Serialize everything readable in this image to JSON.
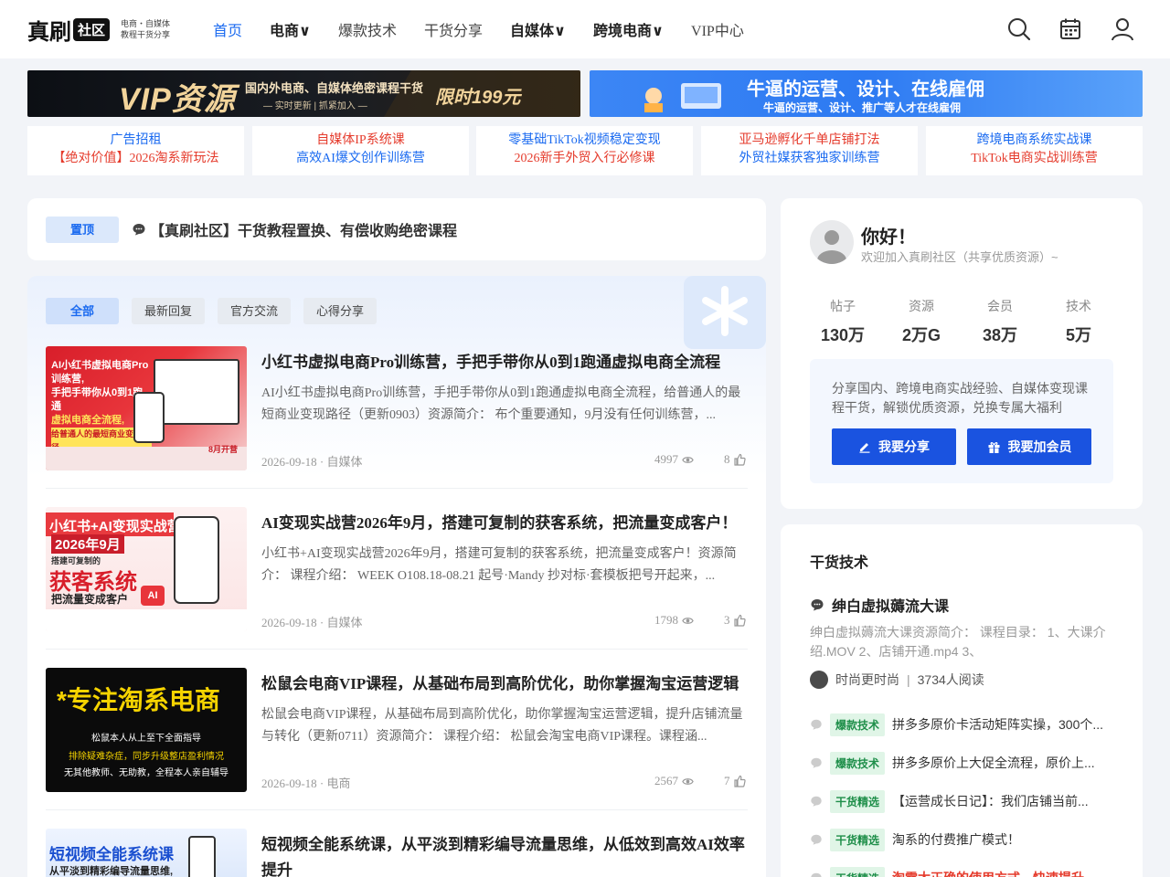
{
  "header": {
    "logo_main": "真刷",
    "logo_badge": "社区",
    "logo_sub_1": "电商・自媒体",
    "logo_sub_2": "教程干货分享",
    "nav": [
      {
        "label": "首页"
      },
      {
        "label": "电商∨"
      },
      {
        "label": "爆款技术"
      },
      {
        "label": "干货分享"
      },
      {
        "label": "自媒体∨"
      },
      {
        "label": "跨境电商∨"
      },
      {
        "label": "VIP中心"
      }
    ]
  },
  "banners": {
    "vip": {
      "big": "VIP资源",
      "line1": "国内外电商、自媒体绝密课程干货",
      "line2": "— 实时更新 | 抓紧加入 —",
      "price": "限时199元"
    },
    "hire": {
      "big": "牛逼的运营、设计、在线雇佣",
      "small": "牛逼的运营、设计、推广等人才在线雇佣"
    }
  },
  "ads": [
    {
      "line1": "广告招租",
      "line2": "【绝对价值】2026淘系新玩法"
    },
    {
      "line1": "自媒体IP系统课",
      "line2": "高效AI爆文创作训练营"
    },
    {
      "line1": "零基础TikTok视频稳定变现",
      "line2": "2026新手外贸入行必修课"
    },
    {
      "line1": "亚马逊孵化千单店铺打法",
      "line2": "外贸社媒获客独家训练营"
    },
    {
      "line1": "跨境电商系统实战课",
      "line2": "TikTok电商实战训练营"
    }
  ],
  "pinned": {
    "badge": "置顶",
    "title": "【真刷社区】干货教程置换、有偿收购绝密课程"
  },
  "tabs": [
    {
      "label": "全部"
    },
    {
      "label": "最新回复"
    },
    {
      "label": "官方交流"
    },
    {
      "label": "心得分享"
    }
  ],
  "posts": [
    {
      "title": "小红书虚拟电商Pro训练营，手把手带你从0到1跑通虚拟电商全流程",
      "excerpt": "AI小红书虚拟电商Pro训练营，手把手带你从0到1跑通虚拟电商全流程，给普通人的最短商业变现路径（更新0903）资源简介： 布个重要通知，9月没有任何训练营，...",
      "meta": "2026-09-18 · 自媒体",
      "views": "4997",
      "likes": "8",
      "thumb": {
        "l1": "AI小红书虚拟电商Pro训练营,",
        "l2": "手把手带你从0到1跑通",
        "l3": "虚拟电商全流程,",
        "l4": "给普通人的最短商业变现路径",
        "badge": "8月开营"
      }
    },
    {
      "title": "AI变现实战营2026年9月，搭建可复制的获客系统，把流量变成客户！",
      "excerpt": "小红书+AI变现实战营2026年9月，搭建可复制的获客系统，把流量变成客户！资源简介： 课程介绍： WEEK O108.18-08.21 起号·Mandy 抄对标·套模板把号开起来，...",
      "meta": "2026-09-18 · 自媒体",
      "views": "1798",
      "likes": "3",
      "thumb": {
        "l1": "小红书+AI变现实战营",
        "l2": "2026年9月",
        "l3": "搭建可复制的",
        "l4": "获客系统",
        "l5": "把流量变成客户"
      }
    },
    {
      "title": "松鼠会电商VIP课程，从基础布局到高阶优化，助你掌握淘宝运营逻辑",
      "excerpt": "松鼠会电商VIP课程，从基础布局到高阶优化，助你掌握淘宝运营逻辑，提升店铺流量与转化（更新0711）资源简介： 课程介绍： 松鼠会淘宝电商VIP课程。课程涵...",
      "meta": "2026-09-18 · 电商",
      "views": "2567",
      "likes": "7",
      "thumb": {
        "l1": "*专注淘系电商",
        "l2": "松鼠本人从上至下全面指导",
        "l3": "排除疑难杂症，同步升级整店盈利情况",
        "l4": "无其他教师、无助教，全程本人亲自辅导"
      }
    },
    {
      "title": "短视频全能系统课，从平淡到精彩编导流量思维，从低效到高效AI效率提升",
      "thumb": {
        "l1": "短视频全能系统课",
        "l2": "从平淡到精彩编导流量思维,"
      }
    }
  ],
  "profile": {
    "hello": "你好！",
    "welcome": "欢迎加入真刷社区（共享优质资源）~",
    "stats": [
      {
        "label": "帖子",
        "value": "130万"
      },
      {
        "label": "资源",
        "value": "2万G"
      },
      {
        "label": "会员",
        "value": "38万"
      },
      {
        "label": "技术",
        "value": "5万"
      }
    ],
    "share_text": "分享国内、跨境电商实战经验、自媒体变现课程干货，解锁优质资源，兑换专属大福利",
    "btn_share": "我要分享",
    "btn_member": "我要加会员"
  },
  "tech": {
    "title": "干货技术",
    "featured": {
      "title": "绅白虚拟薅流大课",
      "excerpt": "绅白虚拟薅流大课资源简介： 课程目录： 1、大课介绍.MOV 2、店铺开通.mp4 3、",
      "author": "时尚更时尚",
      "sep": "|",
      "reads": "3734人阅读"
    },
    "list": [
      {
        "tag": "爆款技术",
        "text": "拼多多原价卡活动矩阵实操，300个..."
      },
      {
        "tag": "爆款技术",
        "text": "拼多多原价上大促全流程，原价上..."
      },
      {
        "tag": "干货精选",
        "text": "【运营成长日记】：我们店铺当前..."
      },
      {
        "tag": "干货精选",
        "text": "淘系的付费推广模式！"
      },
      {
        "tag": "干货精选",
        "text": "淘需太正确的使用方式，快速提升"
      }
    ]
  },
  "colors": {
    "accent": "#1a6af0",
    "button": "#1a53e0",
    "ad_red": "#e53b2c",
    "tag_green": "#1f8f4a"
  }
}
